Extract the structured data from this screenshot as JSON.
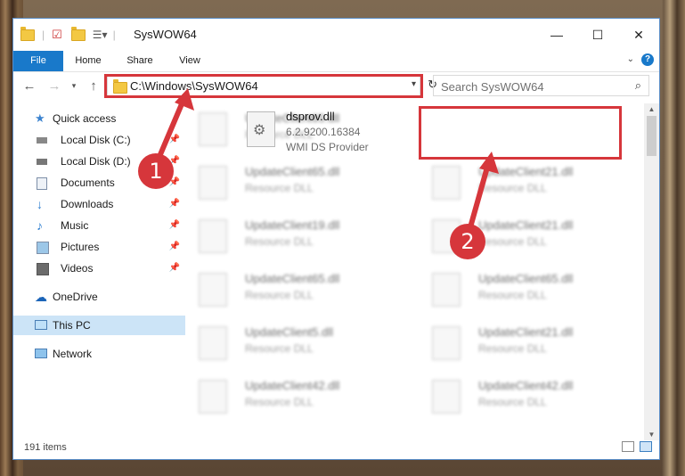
{
  "window": {
    "title": "SysWOW64"
  },
  "ribbon": {
    "tabs": [
      "File",
      "Home",
      "Share",
      "View"
    ],
    "help": "?"
  },
  "address": {
    "path": "C:\\Windows\\SysWOW64",
    "search_placeholder": "Search SysWOW64"
  },
  "nav": {
    "items": [
      {
        "label": "Quick access",
        "icon": "star-icon"
      },
      {
        "label": "Local Disk (C:)",
        "icon": "drive-icon"
      },
      {
        "label": "Local Disk (D:)",
        "icon": "drive-icon"
      },
      {
        "label": "Documents",
        "icon": "documents-icon"
      },
      {
        "label": "Downloads",
        "icon": "download-icon"
      },
      {
        "label": "Music",
        "icon": "music-icon"
      },
      {
        "label": "Pictures",
        "icon": "pictures-icon"
      },
      {
        "label": "Videos",
        "icon": "videos-icon"
      },
      {
        "label": "OneDrive",
        "icon": "cloud-icon"
      },
      {
        "label": "This PC",
        "icon": "computer-icon"
      },
      {
        "label": "Network",
        "icon": "network-icon"
      }
    ]
  },
  "files": {
    "highlighted": {
      "name": "dsprov.dll",
      "version": "6.2.9200.16384",
      "description": "WMI DS Provider"
    },
    "left_column": [
      {
        "name": "UpdateClient65.dll",
        "type": "Resource DLL"
      },
      {
        "name": "UpdateClient65.dll",
        "type": "Resource DLL"
      },
      {
        "name": "UpdateClient19.dll",
        "type": "Resource DLL"
      },
      {
        "name": "UpdateClient65.dll",
        "type": "Resource DLL"
      },
      {
        "name": "UpdateClient5.dll",
        "type": "Resource DLL"
      },
      {
        "name": "UpdateClient42.dll",
        "type": "Resource DLL"
      }
    ],
    "right_column": [
      {
        "name": "UpdateClient21.dll",
        "type": "Resource DLL"
      },
      {
        "name": "UpdateClient21.dll",
        "type": "Resource DLL"
      },
      {
        "name": "UpdateClient65.dll",
        "type": "Resource DLL"
      },
      {
        "name": "UpdateClient21.dll",
        "type": "Resource DLL"
      },
      {
        "name": "UpdateClient42.dll",
        "type": "Resource DLL"
      }
    ]
  },
  "status": {
    "count": "191 items"
  },
  "annotations": {
    "badge1": "1",
    "badge2": "2",
    "color": "#d6363b"
  }
}
